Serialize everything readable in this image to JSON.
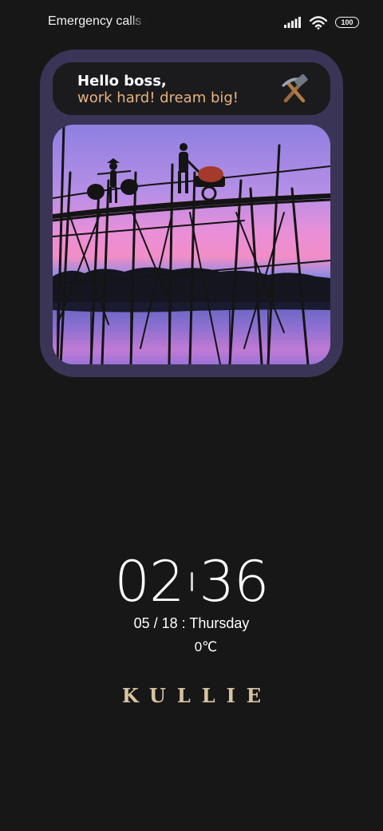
{
  "status_bar": {
    "carrier_text": "Emergency calls o",
    "battery_level": "100",
    "icons": [
      "signal-icon",
      "wifi-icon",
      "battery-icon"
    ]
  },
  "widget": {
    "greeting_title": "Hello boss,",
    "greeting_subtitle": "work hard! dream big!",
    "icon": "hammer-and-pick-icon",
    "photo": "silhouettes-crossing-bamboo-bridge-at-dusk"
  },
  "clock": {
    "hours": "02",
    "minutes": "36"
  },
  "date_text": "05 / 18 : Thursday",
  "temperature_text": "0℃",
  "signature_text": "KULLIE",
  "colors": {
    "background": "#171717",
    "widget_frame": "#3a3556",
    "greeting_card": "#1b1b1e",
    "greeting_accent": "#e6b27e",
    "signature": "#d7c3a3"
  }
}
